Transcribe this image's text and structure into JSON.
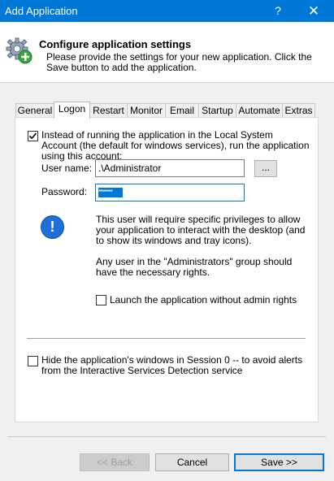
{
  "window": {
    "title": "Add Application",
    "help_glyph": "?",
    "close_glyph": "✕"
  },
  "header": {
    "title": "Configure application settings",
    "description": "Please provide the settings for your new application. Click the Save button to add the application.",
    "icon": "gear-plus-icon"
  },
  "tabs": [
    {
      "label": "General",
      "active": false
    },
    {
      "label": "Logon",
      "active": true
    },
    {
      "label": "Restart",
      "active": false
    },
    {
      "label": "Monitor",
      "active": false
    },
    {
      "label": "Email",
      "active": false
    },
    {
      "label": "Startup",
      "active": false
    },
    {
      "label": "Automate",
      "active": false
    },
    {
      "label": "Extras",
      "active": false
    }
  ],
  "logon": {
    "run_as_label": "Instead of running the application in the Local System Account (the default for windows services), run the application using this account:",
    "run_as_checked": true,
    "user_name_label": "User name:",
    "user_name_value": ".\\Administrator",
    "browse_label": "...",
    "password_label": "Password:",
    "password_value": "********",
    "info_glyph": "!",
    "info_text_1": "This user will require specific privileges to allow your application to interact with the desktop (and to show its windows and tray icons).",
    "info_text_2": "Any user in the \"Administrators\" group should have the necessary rights.",
    "no_admin_label": "Launch the application without admin rights",
    "no_admin_checked": false,
    "hide_session0_label": "Hide the application's windows in Session 0 -- to avoid alerts from the Interactive Services Detection service",
    "hide_session0_checked": false
  },
  "footer": {
    "back_label": "<< Back",
    "cancel_label": "Cancel",
    "save_label": "Save >>"
  }
}
